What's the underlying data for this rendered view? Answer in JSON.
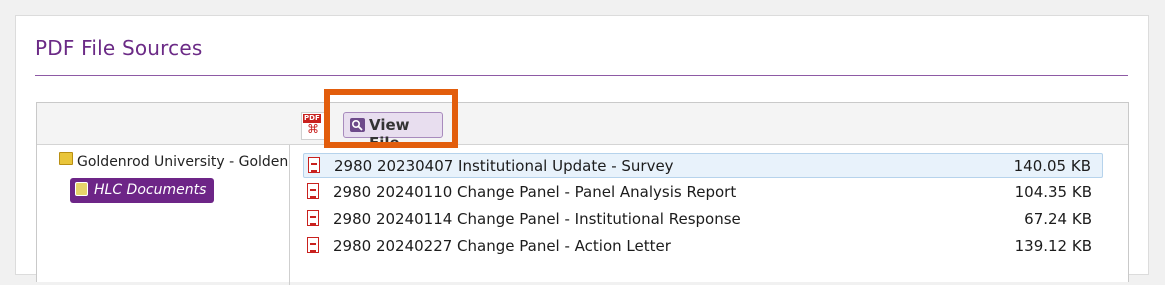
{
  "panel": {
    "title": "PDF File Sources"
  },
  "toolbar": {
    "pdf_icon_text": "PDF",
    "view_file_label": "View File"
  },
  "tree": {
    "root_label": "Goldenrod University - Goldenrod",
    "selected_node": "HLC Documents"
  },
  "files": [
    {
      "name": "2980 20230407 Institutional Update - Survey",
      "size": "140.05 KB"
    },
    {
      "name": "2980 20240110 Change Panel - Panel Analysis Report",
      "size": "104.35 KB"
    },
    {
      "name": "2980 20240114 Change Panel - Institutional Response",
      "size": "67.24 KB"
    },
    {
      "name": "2980 20240227 Change Panel - Action Letter",
      "size": "139.12 KB"
    }
  ],
  "colors": {
    "brand_purple": "#6d2587",
    "highlight_orange": "#e25d0c",
    "pdf_red": "#c9211e"
  },
  "icons": [
    "pdf-icon",
    "magnifier-icon",
    "folder-icon",
    "document-library-icon",
    "pdf-file-icon"
  ]
}
